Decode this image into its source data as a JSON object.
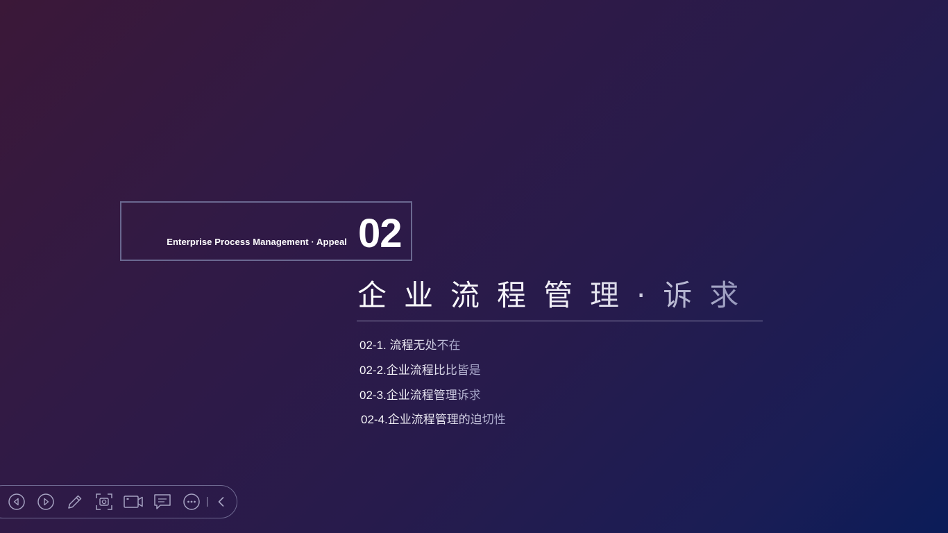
{
  "slide": {
    "subtitle_en": "Enterprise Process Management  · Appeal",
    "section_number": "02",
    "main_title": "企业流程管理·诉求",
    "toc": [
      "02-1. 流程无处不在",
      "02-2.企业流程比比皆是",
      "02-3.企业流程管理诉求",
      "02-4.企业流程管理的迫切性"
    ]
  },
  "toolbar": {
    "icons": [
      "previous-icon",
      "next-icon",
      "pen-icon",
      "screenshot-icon",
      "camera-icon",
      "comment-icon",
      "more-icon",
      "collapse-icon"
    ]
  },
  "colors": {
    "background_start": "#3b1838",
    "background_end": "#0b1c58",
    "frame_border": "#6a6890",
    "text": "#ffffff"
  }
}
